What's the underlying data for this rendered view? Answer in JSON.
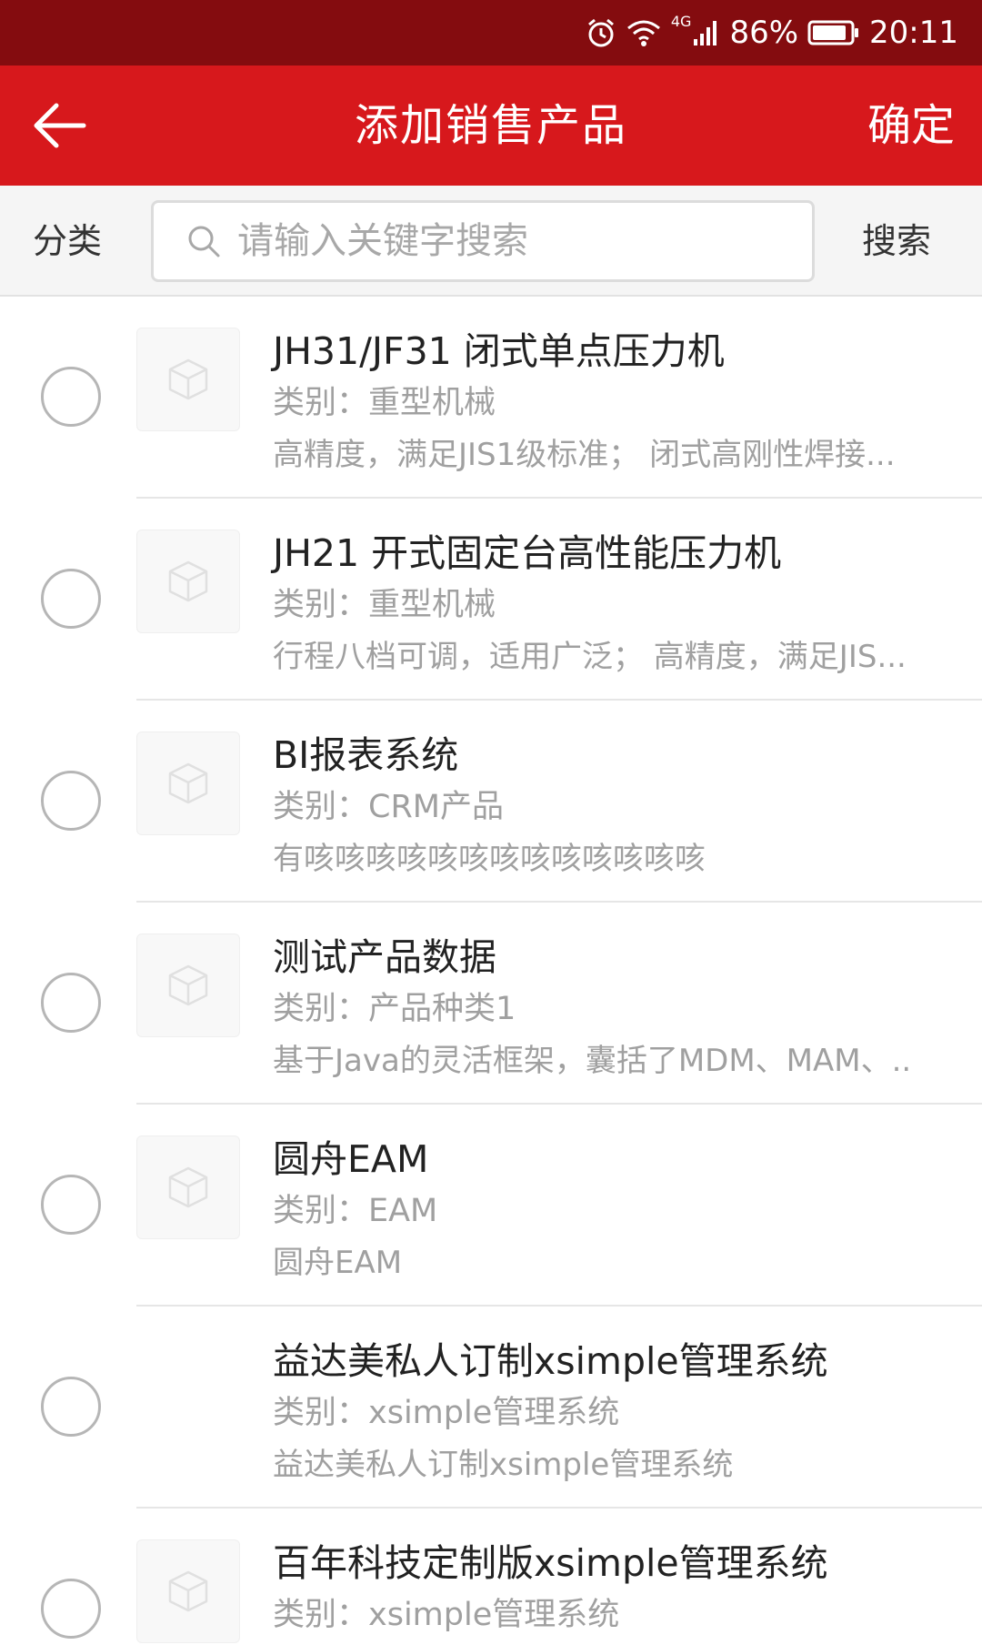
{
  "status_bar": {
    "battery": "86%",
    "time": "20:11",
    "network": "4G",
    "icons": [
      "alarm-icon",
      "wifi-icon",
      "signal-icon",
      "battery-icon"
    ]
  },
  "header": {
    "title": "添加销售产品",
    "confirm_label": "确定",
    "back_icon": "arrow-left-icon"
  },
  "search": {
    "category_label": "分类",
    "placeholder": "请输入关键字搜索",
    "value": "",
    "button_label": "搜索"
  },
  "colors": {
    "status_bar": "#840c0f",
    "app_bar": "#d7181c",
    "search_bar": "#f5f5f5"
  },
  "products": [
    {
      "name": "JH31/JF31 闭式单点压力机",
      "category": "类别：重型机械",
      "description": "高精度，满足JIS1级标准； 闭式高刚性焊接...",
      "has_thumbnail": true
    },
    {
      "name": "JH21 开式固定台高性能压力机",
      "category": "类别：重型机械",
      "description": "行程八档可调，适用广泛； 高精度，满足JIS...",
      "has_thumbnail": true
    },
    {
      "name": "BI报表系统",
      "category": "类别：CRM产品",
      "description": "有咳咳咳咳咳咳咳咳咳咳咳咳咳",
      "has_thumbnail": true
    },
    {
      "name": "测试产品数据",
      "category": "类别：产品种类1",
      "description": "基于Java的灵活框架，囊括了MDM、MAM、..",
      "has_thumbnail": true
    },
    {
      "name": "圆舟EAM",
      "category": "类别：EAM",
      "description": "圆舟EAM",
      "has_thumbnail": true
    },
    {
      "name": "益达美私人订制xsimple管理系统",
      "category": "类别：xsimple管理系统",
      "description": "益达美私人订制xsimple管理系统",
      "has_thumbnail": false
    },
    {
      "name": "百年科技定制版xsimple管理系统",
      "category": "类别：xsimple管理系统",
      "description": "",
      "has_thumbnail": true
    }
  ]
}
